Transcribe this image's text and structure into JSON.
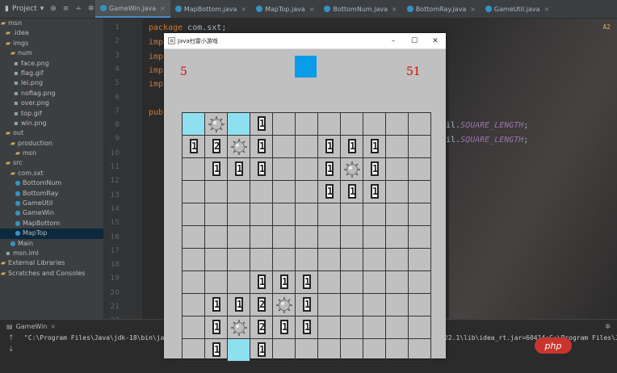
{
  "ide": {
    "project_label": "Project",
    "tabs": [
      {
        "label": "GameWin.java",
        "active": true
      },
      {
        "label": "MapBottom.java",
        "active": false
      },
      {
        "label": "MapTop.java",
        "active": false
      },
      {
        "label": "BottomNum.java",
        "active": false
      },
      {
        "label": "BottomRay.java",
        "active": false
      },
      {
        "label": "GameUtil.java",
        "active": false
      }
    ],
    "tree": [
      {
        "label": "msn",
        "kind": "folder"
      },
      {
        "label": ".idea",
        "kind": "folder"
      },
      {
        "label": "imgs",
        "kind": "folder"
      },
      {
        "label": "num",
        "kind": "folder"
      },
      {
        "label": "face.png",
        "kind": "file"
      },
      {
        "label": "flag.gif",
        "kind": "file"
      },
      {
        "label": "lei.png",
        "kind": "file"
      },
      {
        "label": "noflag.png",
        "kind": "file"
      },
      {
        "label": "over.png",
        "kind": "file"
      },
      {
        "label": "top.gif",
        "kind": "file"
      },
      {
        "label": "win.png",
        "kind": "file"
      },
      {
        "label": "out",
        "kind": "folder"
      },
      {
        "label": "production",
        "kind": "folder"
      },
      {
        "label": "msn",
        "kind": "folder"
      },
      {
        "label": "src",
        "kind": "folder"
      },
      {
        "label": "com.sxt",
        "kind": "folder"
      },
      {
        "label": "BottomNum",
        "kind": "class"
      },
      {
        "label": "BottomRay",
        "kind": "class"
      },
      {
        "label": "GameUtil",
        "kind": "class"
      },
      {
        "label": "GameWin",
        "kind": "class"
      },
      {
        "label": "MapBottom",
        "kind": "class"
      },
      {
        "label": "MapTop",
        "kind": "class",
        "selected": true
      },
      {
        "label": "Main",
        "kind": "class"
      },
      {
        "label": "msn.iml",
        "kind": "file"
      },
      {
        "label": "External Libraries",
        "kind": "folder"
      },
      {
        "label": "Scratches and Consoles",
        "kind": "folder"
      }
    ],
    "line_numbers": [
      "1",
      "2",
      "3",
      "4",
      "5",
      "6",
      "7",
      "8",
      "9",
      "10",
      "11",
      "12",
      "13",
      "14",
      "15",
      "16",
      "17",
      "18",
      "19",
      "20",
      "21",
      "22"
    ],
    "code": {
      "package_kw": "package",
      "package_name": " com.sxt;",
      "imp": [
        "imp",
        "imp",
        "imp",
        "imp"
      ],
      "pub": "pub",
      "right1_prefix": "il.",
      "right1_const": "SQUARE_LENGTH",
      "right1_suffix": ";",
      "right2_prefix": "il.",
      "right2_const": "SQUARE_LENGTH",
      "right2_suffix": ";",
      "warn": "A2"
    },
    "run": {
      "tab_label": "GameWin",
      "cmd_left": "\"C:\\Program Files\\Java\\jdk-18\\bin\\java.",
      "cmd_right": "22.1\\lib\\idea_rt.jar=60414:C:\\Program Files\\J"
    },
    "watermark": "php"
  },
  "game": {
    "window_title": "Java扫雷小游戏",
    "controls": {
      "minimize": "–",
      "maximize": "☐",
      "close": "✕"
    },
    "mine_count": "5",
    "timer": "51",
    "colors": {
      "face": "#0a9ce8",
      "flag": "#8ee0f0",
      "counter": "#e00000"
    },
    "grid": [
      [
        "F",
        "M",
        "F",
        "1",
        "",
        "",
        "",
        "",
        "",
        "",
        ""
      ],
      [
        "1",
        "2",
        "M",
        "1",
        "",
        "",
        "1",
        "1",
        "1",
        "",
        ""
      ],
      [
        "",
        "1",
        "1",
        "1",
        "",
        "",
        "1",
        "M",
        "1",
        "",
        ""
      ],
      [
        "",
        "",
        "",
        "",
        "",
        "",
        "1",
        "1",
        "1",
        "",
        ""
      ],
      [
        "",
        "",
        "",
        "",
        "",
        "",
        "",
        "",
        "",
        "",
        ""
      ],
      [
        "",
        "",
        "",
        "",
        "",
        "",
        "",
        "",
        "",
        "",
        ""
      ],
      [
        "",
        "",
        "",
        "",
        "",
        "",
        "",
        "",
        "",
        "",
        ""
      ],
      [
        "",
        "",
        "",
        "1",
        "1",
        "1",
        "",
        "",
        "",
        "",
        ""
      ],
      [
        "",
        "1",
        "1",
        "2",
        "M",
        "1",
        "",
        "",
        "",
        "",
        ""
      ],
      [
        "",
        "1",
        "M",
        "2",
        "1",
        "1",
        "",
        "",
        "",
        "",
        ""
      ],
      [
        "",
        "1",
        "F",
        "1",
        "",
        "",
        "",
        "",
        "",
        "",
        ""
      ]
    ]
  }
}
